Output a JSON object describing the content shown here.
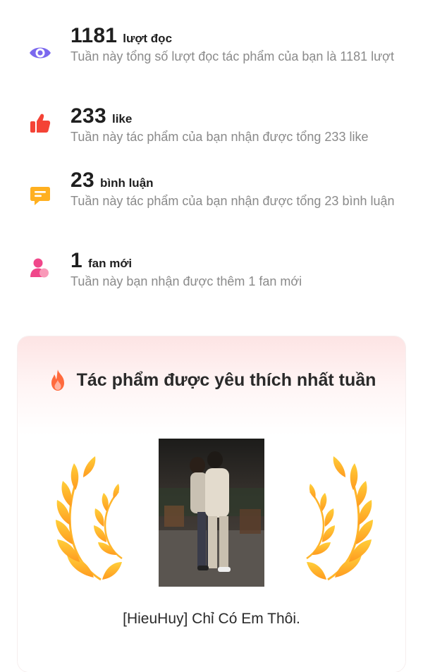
{
  "stats": [
    {
      "icon": "eye-icon",
      "value": "1181",
      "unit": "lượt đọc",
      "desc": "Tuần này tổng số lượt đọc tác phẩm của bạn là 1181 lượt",
      "color": "#7b68ee"
    },
    {
      "icon": "thumbs-up-icon",
      "value": "233",
      "unit": "like",
      "desc": "Tuần này tác phẩm của bạn nhận được tổng 233 like",
      "color": "#f44336"
    },
    {
      "icon": "comment-icon",
      "value": "23",
      "unit": "bình luận",
      "desc": "Tuần này tác phẩm của bạn nhận được tổng 23 bình luận",
      "color": "#ffb020"
    },
    {
      "icon": "user-icon",
      "value": "1",
      "unit": "fan mới",
      "desc": "Tuần này bạn nhận được thêm 1 fan mới",
      "color": "#f0478a"
    }
  ],
  "favorite": {
    "title": "Tác phẩm được yêu thích nhất tuần",
    "book_title": "[HieuHuy] Chỉ Có Em Thôi.",
    "accent": "#ff7a3c"
  }
}
